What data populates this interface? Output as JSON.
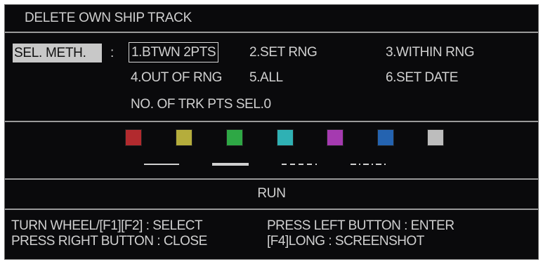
{
  "dialog": {
    "title": "DELETE OWN SHIP TRACK"
  },
  "selection": {
    "label": "SEL. METH.",
    "colon": ":",
    "options": [
      {
        "label": "1.BTWN 2PTS",
        "selected": true
      },
      {
        "label": "2.SET RNG",
        "selected": false
      },
      {
        "label": "3.WITHIN RNG",
        "selected": false
      },
      {
        "label": "4.OUT OF RNG",
        "selected": false
      },
      {
        "label": "5.ALL",
        "selected": false
      },
      {
        "label": "6.SET DATE",
        "selected": false
      }
    ],
    "points_selected": "NO. OF TRK PTS SEL.0"
  },
  "colors": [
    {
      "name": "red",
      "hex": "#b22a2e"
    },
    {
      "name": "yellow",
      "hex": "#b5ad3c"
    },
    {
      "name": "green",
      "hex": "#2ea845"
    },
    {
      "name": "cyan",
      "hex": "#2fb1b4"
    },
    {
      "name": "magenta",
      "hex": "#a53ab0"
    },
    {
      "name": "blue",
      "hex": "#2463b0"
    },
    {
      "name": "white",
      "hex": "#bdbdbd"
    }
  ],
  "line_styles": [
    "thin-solid",
    "thick-solid",
    "dashed",
    "dash-dot"
  ],
  "run_label": "RUN",
  "help": {
    "select": "TURN WHEEL/[F1][F2] : SELECT",
    "enter": "PRESS LEFT BUTTON : ENTER",
    "close": "PRESS RIGHT BUTTON : CLOSE",
    "screenshot": "[F4]LONG : SCREENSHOT"
  }
}
